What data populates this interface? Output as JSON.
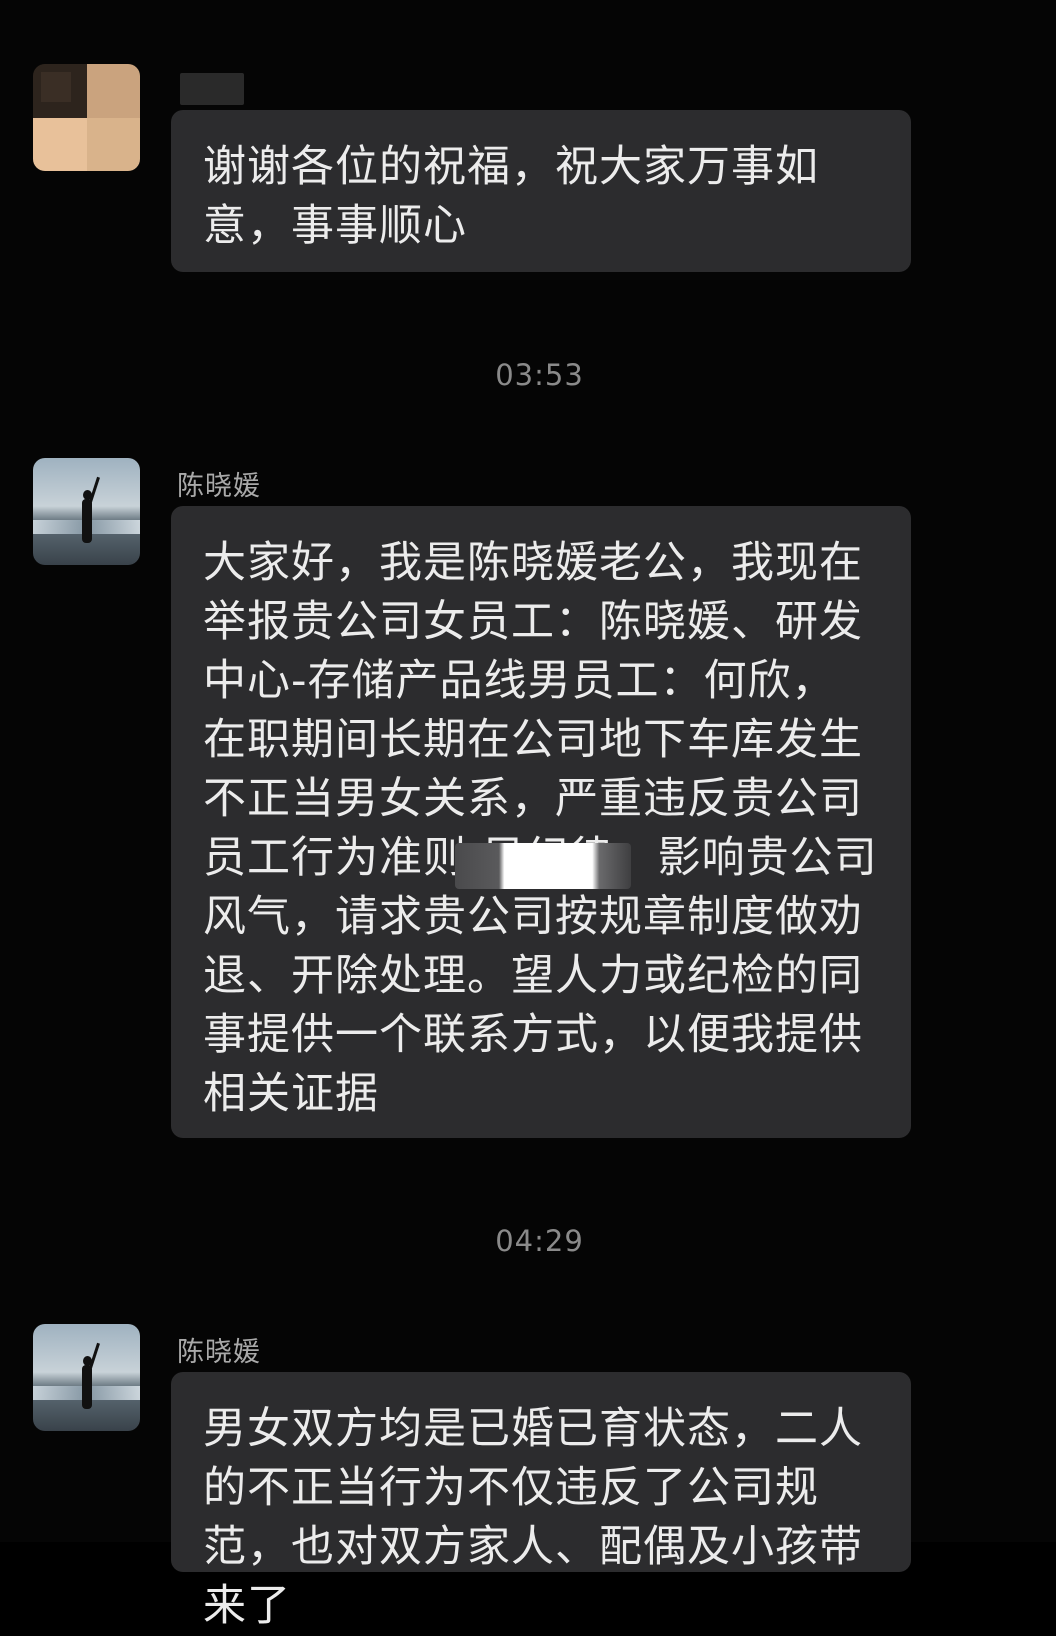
{
  "chat": {
    "messages": [
      {
        "sender": "",
        "text": "谢谢各位的祝福，祝大家万事如意，事事顺心"
      },
      {
        "timestamp": "03:53"
      },
      {
        "sender": "陈晓媛",
        "text": "大家好，我是陈晓媛老公，我现在举报贵公司女员工：陈晓媛、研发中心-存储产品线男员工：何欣，在职期间长期在公司地下车库发生不正当男女关系，严重违反贵公司员工行为准则              风纪律，影响贵公司风气，请求贵公司按规章制度做劝退、开除处理。望人力或纪检的同事提供一个联系方式，以便我提供相关证据"
      },
      {
        "timestamp": "04:29"
      },
      {
        "sender": "陈晓媛",
        "text": "男女双方均是已婚已育状态，二人的不正当行为不仅违反了公司规范，也对双方家人、配偶及小孩带来了"
      }
    ]
  },
  "colors": {
    "background": "#050505",
    "bubble": "#2c2c2e",
    "text": "#ececec",
    "meta": "#8a8a8a"
  },
  "icons": {
    "avatar_1": "pixelated-avatar",
    "avatar_2": "beach-silhouette-avatar"
  }
}
